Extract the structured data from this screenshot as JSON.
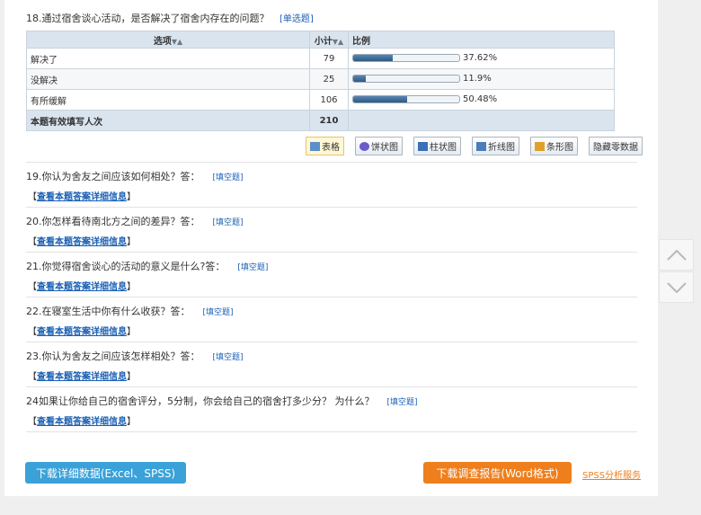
{
  "q18": {
    "title": "18.通过宿舍谈心活动，是否解决了宿舍内存在的问题？",
    "type": "[单选题]",
    "headers": {
      "option": "选项",
      "count": "小计",
      "pct": "比例"
    },
    "rows": [
      {
        "label": "解决了",
        "count": "79",
        "pct": "37.62%",
        "value": 0.3762
      },
      {
        "label": "没解决",
        "count": "25",
        "pct": "11.9%",
        "value": 0.119
      },
      {
        "label": "有所缓解",
        "count": "106",
        "pct": "50.48%",
        "value": 0.5048
      }
    ],
    "total": {
      "label": "本题有效填写人次",
      "count": "210"
    }
  },
  "toolbar": [
    {
      "label": "表格",
      "icon": "table-icon",
      "color": "#5b8fc7",
      "active": true
    },
    {
      "label": "饼状图",
      "icon": "pie-chart-icon",
      "color": "#6a5acd"
    },
    {
      "label": "柱状图",
      "icon": "bar-chart-icon",
      "color": "#3b6fb6"
    },
    {
      "label": "折线图",
      "icon": "line-chart-icon",
      "color": "#4a7ebb"
    },
    {
      "label": "条形图",
      "icon": "horizontal-bar-chart-icon",
      "color": "#e0a12b"
    },
    {
      "label": "隐藏零数据",
      "icon": ""
    }
  ],
  "questions": [
    {
      "title": "19.你认为舍友之间应该如何相处？答：",
      "type": "[填空题]"
    },
    {
      "title": "20.你怎样看待南北方之间的差异？答：",
      "type": "[填空题]"
    },
    {
      "title": "21.你觉得宿舍谈心的活动的意义是什么?答：",
      "type": "[填空题]"
    },
    {
      "title": "22.在寝室生活中你有什么收获？答：",
      "type": "[填空题]"
    },
    {
      "title": "23.你认为舍友之间应该怎样相处？答：",
      "type": "[填空题]"
    },
    {
      "title": "24如果让你给自己的宿舍评分，5分制，你会给自己的宿舍打多少分？ 为什么？",
      "type": "[填空题]"
    }
  ],
  "detail": {
    "open": "【",
    "link": "查看本题答案详细信息",
    "close": "】"
  },
  "buttons": {
    "download_data": "下载详细数据(Excel、SPSS)",
    "download_report": "下载调查报告(Word格式)",
    "spss_service": "SPSS分析服务"
  },
  "colors": {
    "accent_blue": "#3aa1d9",
    "accent_orange": "#ef7e1c",
    "link": "#1a5fb4"
  }
}
